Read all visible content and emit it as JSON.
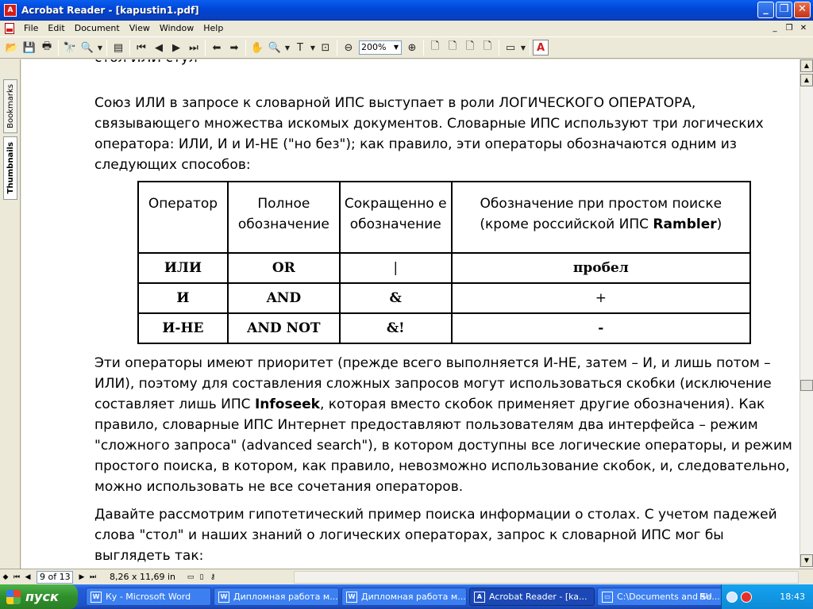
{
  "window": {
    "title": "Acrobat Reader - [kapustin1.pdf]",
    "app_icon_label": "A"
  },
  "menu": {
    "items": [
      "File",
      "Edit",
      "Document",
      "View",
      "Window",
      "Help"
    ]
  },
  "toolbar": {
    "zoom_value": "200%"
  },
  "sidebar": {
    "tabs": [
      "Bookmarks",
      "Thumbnails"
    ]
  },
  "document": {
    "top_fragment": "стол ИЛИ стул",
    "para1": "Союз ИЛИ в запросе к словарной ИПС выступает в роли ЛОГИЧЕСКОГО ОПЕРАТОРА, связывающего множества искомых документов. Словарные ИПС используют три логических оператора: ИЛИ, И и И-НЕ (\"но без\"); как правило, эти операторы обозначаются одним из следующих способов:",
    "table": {
      "headers": [
        "Оператор",
        "Полное обозначение",
        "Сокращенно е обозначение",
        "Обозначение при простом поиске (кроме российской ИПС "
      ],
      "header_bold_suffix": "Rambler",
      "header_close": ")",
      "rows": [
        [
          "ИЛИ",
          "OR",
          "|",
          "пробел"
        ],
        [
          "И",
          "AND",
          "&",
          "+"
        ],
        [
          "И-НЕ",
          "AND NOT",
          "&!",
          "-"
        ]
      ]
    },
    "para2_a": "Эти операторы имеют приоритет (прежде всего выполняется И-НЕ, затем – И, и лишь потом – ИЛИ), поэтому для составления сложных запросов могут использоваться скобки (исключение составляет лишь ИПС ",
    "para2_bold": "Infoseek",
    "para2_b": ", которая вместо скобок применяет другие обозначения). Как правило, словарные ИПС Интернет предоставляют пользователям два интерфейса – режим \"сложного запроса\" (advanced search\"), в котором доступны все логические операторы, и режим простого поиска, в котором, как правило, невозможно использование скобок, и, следовательно, можно использовать не все сочетания операторов.",
    "para3": "Давайте рассмотрим гипотетический пример поиска информации о столах. С учетом падежей слова \"стол\" и наших знаний о логических операторах, запрос к словарной ИПС мог бы выглядеть так:"
  },
  "navbar": {
    "page_field": "9 of 13",
    "page_size": "8,26 x 11,69 in"
  },
  "taskbar": {
    "start_label": "пуск",
    "tasks": [
      {
        "label": "Ку - Microsoft Word",
        "icon": "W"
      },
      {
        "label": "Дипломная работа м...",
        "icon": "W"
      },
      {
        "label": "Дипломная работа м...",
        "icon": "W"
      },
      {
        "label": "Acrobat Reader - [ka...",
        "icon": "A"
      },
      {
        "label": "C:\\Documents and Se...",
        "icon": "▭"
      }
    ],
    "language": "RU",
    "clock": "18:43"
  }
}
